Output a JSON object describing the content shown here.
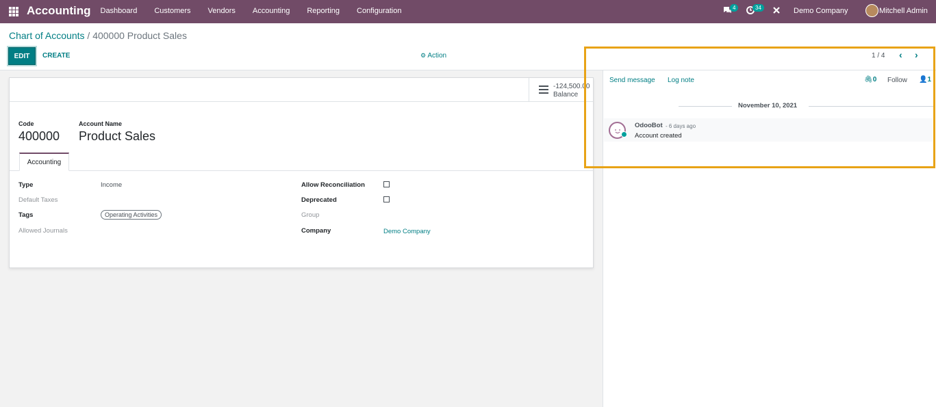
{
  "navbar": {
    "brand": "Accounting",
    "menu": [
      "Dashboard",
      "Customers",
      "Vendors",
      "Accounting",
      "Reporting",
      "Configuration"
    ],
    "messages_badge": "4",
    "activities_badge": "34",
    "company": "Demo Company",
    "user": "Mitchell Admin"
  },
  "control": {
    "breadcrumb_parent": "Chart of Accounts",
    "breadcrumb_sep": "/",
    "breadcrumb_current": "400000 Product Sales",
    "edit_label": "EDIT",
    "create_label": "CREATE",
    "action_label": "Action",
    "pager": "1 / 4"
  },
  "form": {
    "stat_value": "-124,500.00",
    "stat_label": "Balance",
    "code_label": "Code",
    "code": "400000",
    "name_label": "Account Name",
    "name": "Product Sales",
    "tab": "Accounting",
    "type_label": "Type",
    "type_value": "Income",
    "taxes_label": "Default Taxes",
    "tags_label": "Tags",
    "tag_value": "Operating Activities",
    "journals_label": "Allowed Journals",
    "reconcile_label": "Allow Reconciliation",
    "deprecated_label": "Deprecated",
    "group_label": "Group",
    "company_label": "Company",
    "company_value": "Demo Company"
  },
  "chatter": {
    "send_message": "Send message",
    "log_note": "Log note",
    "attachments": "0",
    "follow": "Follow",
    "followers": "1",
    "date": "November 10, 2021",
    "author": "OdooBot",
    "msg_date": "- 6 days ago",
    "body": "Account created"
  },
  "colors": {
    "navbar": "#714b67",
    "accent": "#017e84",
    "highlight": "#e8a316"
  }
}
